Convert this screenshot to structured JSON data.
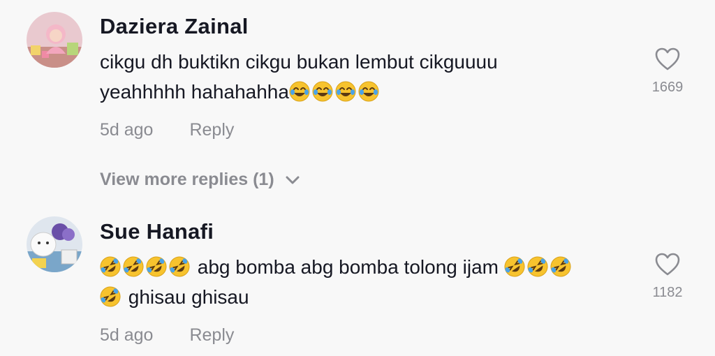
{
  "comments": [
    {
      "username": "Daziera Zainal",
      "text_line1": "cikgu dh buktikn cikgu bukan lembut cikguuuu",
      "text_line2": "yeahhhhh hahahahha",
      "line2_emoji": "face-with-tears-of-joy-icon",
      "line2_emoji_count": 4,
      "time": "5d ago",
      "reply_label": "Reply",
      "likes": "1669"
    },
    {
      "username": "Sue Hanafi",
      "line1_leading_emoji": "rolling-on-floor-laughing-icon",
      "line1_leading_count": 4,
      "text_line1": "abg bomba abg bomba tolong ijam",
      "line1_trailing_count": 3,
      "line2_leading_count": 1,
      "text_line2": "ghisau ghisau",
      "time": "5d ago",
      "reply_label": "Reply",
      "likes": "1182"
    }
  ],
  "view_more": {
    "label": "View more replies (1)",
    "icon": "chevron-down-icon"
  },
  "colors": {
    "background": "#f8f8f8",
    "primary_text": "#161823",
    "secondary_text": "#8a8b91",
    "emoji_face": "#f7c32e"
  }
}
